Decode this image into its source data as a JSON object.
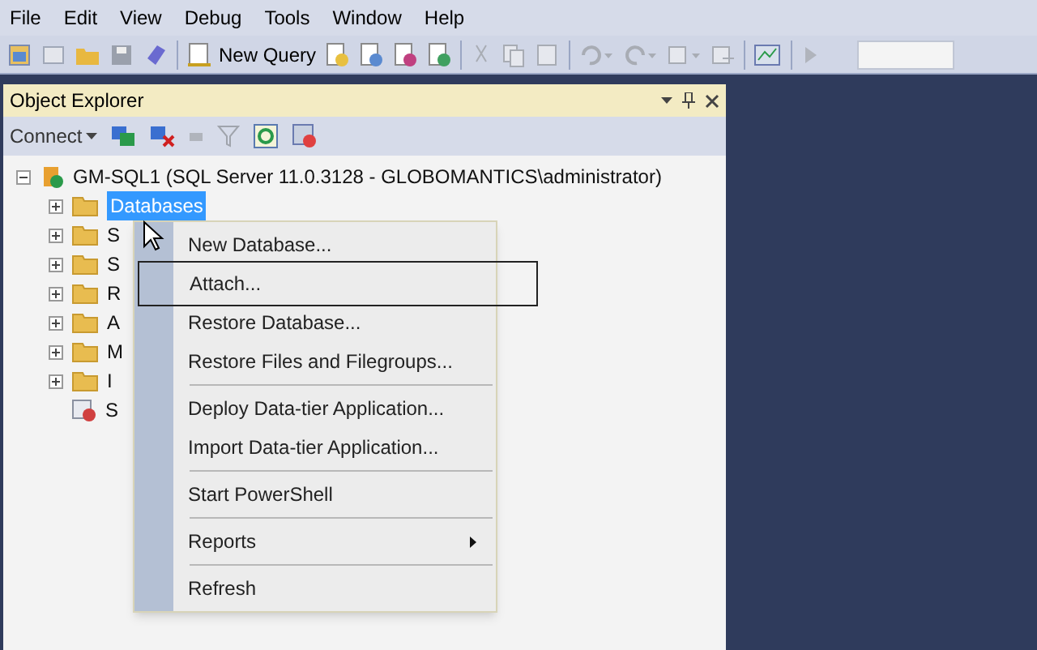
{
  "menu_bar": [
    "File",
    "Edit",
    "View",
    "Debug",
    "Tools",
    "Window",
    "Help"
  ],
  "toolbar": {
    "new_query": "New Query"
  },
  "object_explorer": {
    "title": "Object Explorer",
    "connect": "Connect",
    "tree": [
      {
        "label": "GM-SQL1 (SQL Server 11.0.3128 - GLOBOMANTICS\\administrator)",
        "kind": "server",
        "expanded": true,
        "children": [
          {
            "label": "Databases",
            "kind": "folder",
            "selected": true
          },
          {
            "label": "S",
            "kind": "folder",
            "selected": false
          },
          {
            "label": "S",
            "kind": "folder",
            "selected": false
          },
          {
            "label": "R",
            "kind": "folder",
            "selected": false
          },
          {
            "label": "A",
            "kind": "folder",
            "selected": false
          },
          {
            "label": "M",
            "kind": "folder",
            "selected": false
          },
          {
            "label": "I",
            "kind": "folder",
            "selected": false
          },
          {
            "label": "S",
            "kind": "agent",
            "selected": false
          }
        ]
      }
    ]
  },
  "context_menu": [
    {
      "label": "New Database...",
      "kind": "item"
    },
    {
      "label": "Attach...",
      "kind": "item",
      "highlighted": true
    },
    {
      "label": "Restore Database...",
      "kind": "item"
    },
    {
      "label": "Restore Files and Filegroups...",
      "kind": "item"
    },
    {
      "kind": "separator"
    },
    {
      "label": "Deploy Data-tier Application...",
      "kind": "item"
    },
    {
      "label": "Import Data-tier Application...",
      "kind": "item"
    },
    {
      "kind": "separator"
    },
    {
      "label": "Start PowerShell",
      "kind": "item"
    },
    {
      "kind": "separator"
    },
    {
      "label": "Reports",
      "kind": "submenu"
    },
    {
      "kind": "separator"
    },
    {
      "label": "Refresh",
      "kind": "item"
    }
  ]
}
